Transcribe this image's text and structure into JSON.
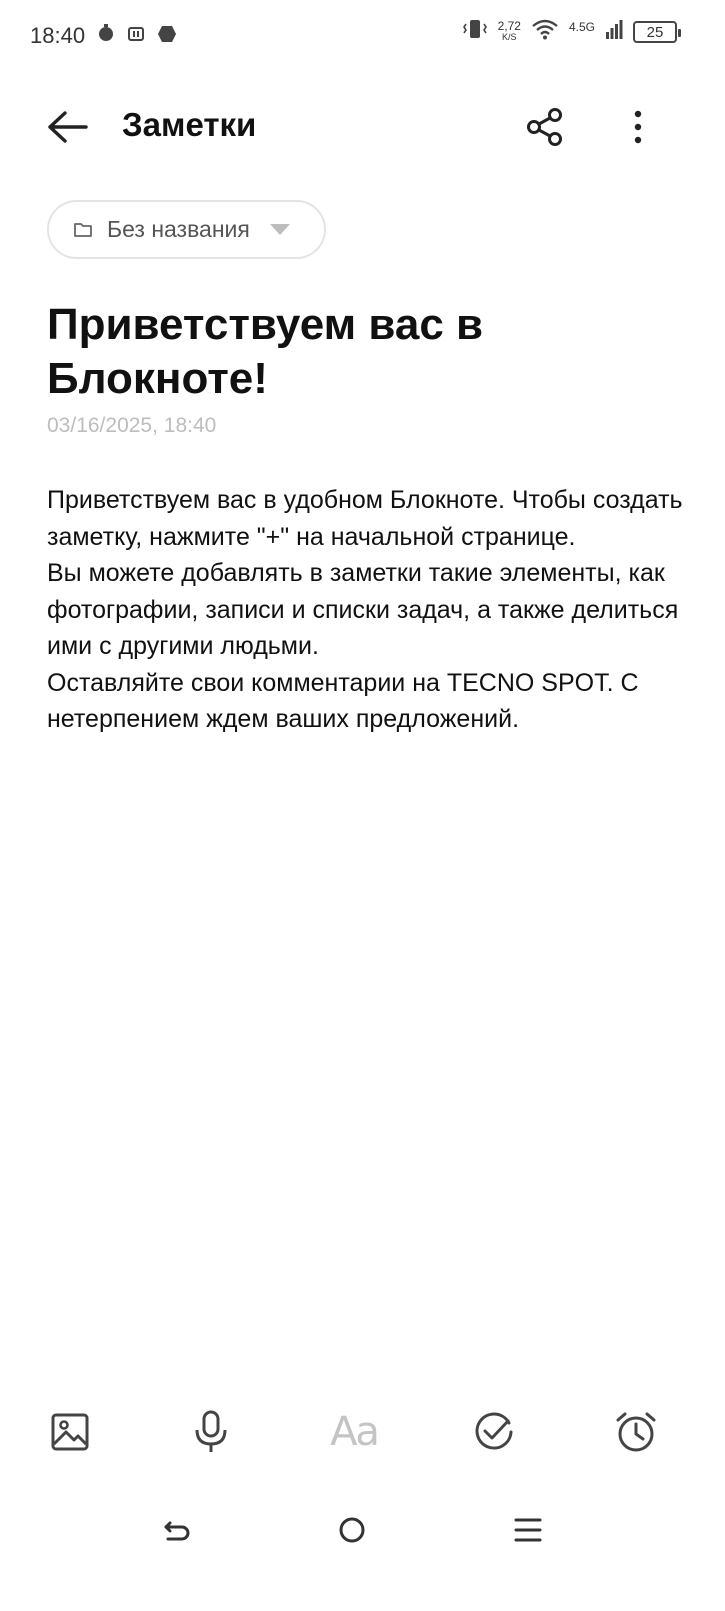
{
  "status_bar": {
    "time": "18:40",
    "net_speed_value": "2,72",
    "net_speed_unit": "K/S",
    "network_type": "4.5G",
    "battery": "25"
  },
  "header": {
    "title": "Заметки"
  },
  "folder": {
    "label": "Без названия"
  },
  "note": {
    "title": "Приветствуем вас в Блокноте!",
    "date": "03/16/2025, 18:40",
    "paragraphs": [
      "Приветствуем вас в удобном Блокноте. Чтобы создать заметку, нажмите \"+\" на начальной странице.",
      "Вы можете добавлять в заметки такие элементы, как фотографии, записи и списки задач, а также делиться ими с другими людьми.",
      "Оставляйте свои комментарии на TECNO SPOT. С нетерпением ждем ваших предложений."
    ]
  },
  "toolbar": {
    "text_format_label": "Aa"
  },
  "icons": {
    "back": "arrow-left-icon",
    "share": "share-icon",
    "more": "more-vertical-icon",
    "folder": "folder-icon",
    "image": "image-icon",
    "mic": "microphone-icon",
    "checklist": "check-circle-icon",
    "alarm": "alarm-clock-icon",
    "nav_back": "nav-back-icon",
    "nav_home": "nav-home-icon",
    "nav_menu": "nav-menu-icon"
  },
  "colors": {
    "text": "#111111",
    "muted": "#bdbdbd",
    "icon": "#444444"
  }
}
